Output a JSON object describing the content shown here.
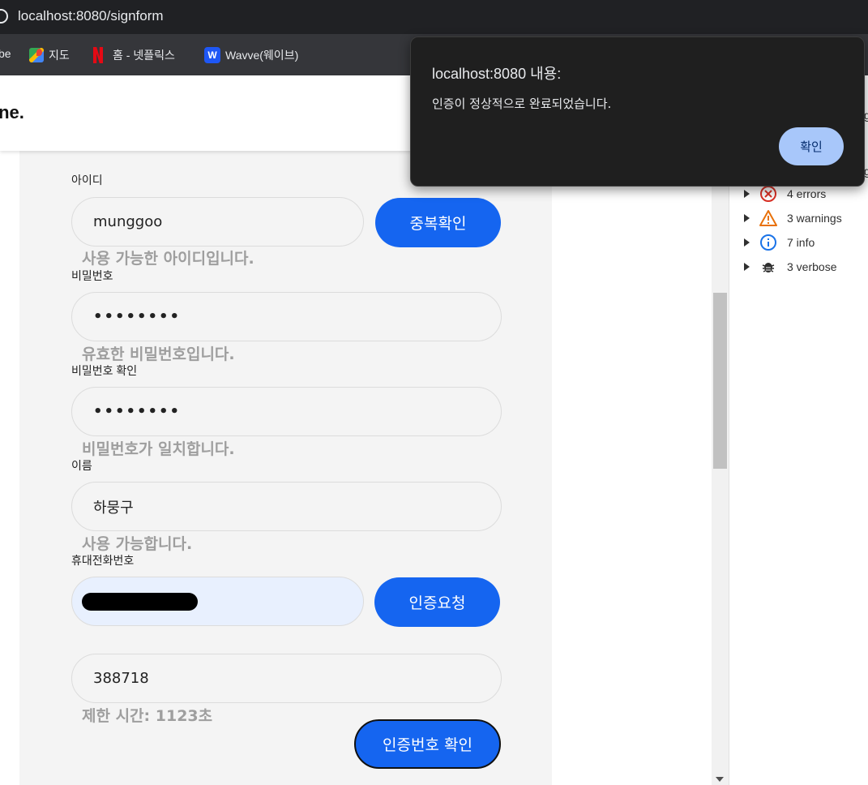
{
  "browser": {
    "url": "localhost:8080/signform",
    "bookmarks": [
      {
        "label": "be",
        "icon": "youtube-icon"
      },
      {
        "label": "지도",
        "icon": "maps-icon"
      },
      {
        "label": "홈 - 넷플릭스",
        "icon": "netflix-icon"
      },
      {
        "label": "Wavve(웨이브)",
        "icon": "wavve-icon"
      }
    ],
    "wavve_icon_letter": "W"
  },
  "header": {
    "brand": "ine."
  },
  "form": {
    "id": {
      "label": "아이디",
      "value": "munggoo",
      "button": "중복확인",
      "message": "사용 가능한 아이디입니다."
    },
    "password": {
      "label": "비밀번호",
      "value": "••••••••",
      "message": "유효한 비밀번호입니다."
    },
    "password_confirm": {
      "label": "비밀번호 확인",
      "value": "••••••••",
      "message": "비밀번호가 일치합니다."
    },
    "name": {
      "label": "이름",
      "value": "하뭉구",
      "message": "사용 가능합니다."
    },
    "phone": {
      "label": "휴대전화번호",
      "button": "인증요청"
    },
    "verification": {
      "value": "388718",
      "timer": "제한 시간: 1123초",
      "button": "인증번호 확인"
    }
  },
  "devtools": {
    "edge_text_1": "g",
    "edge_text_2": "g",
    "rows": [
      {
        "label": "4 errors",
        "icon": "error-icon",
        "color": "#d93025"
      },
      {
        "label": "3 warnings",
        "icon": "warning-icon",
        "color": "#e8710a"
      },
      {
        "label": "7 info",
        "icon": "info-icon",
        "color": "#1a73e8"
      },
      {
        "label": "3 verbose",
        "icon": "bug-icon",
        "color": "#303030"
      }
    ]
  },
  "dialog": {
    "title": "localhost:8080 내용:",
    "message": "인증이 정상적으로 완료되었습니다.",
    "ok_label": "확인"
  },
  "colors": {
    "primary_button": "#1565f0",
    "dialog_bg": "#1f1f1f",
    "dialog_button": "#a8c7fa",
    "hint_text": "#9e9e9e"
  }
}
